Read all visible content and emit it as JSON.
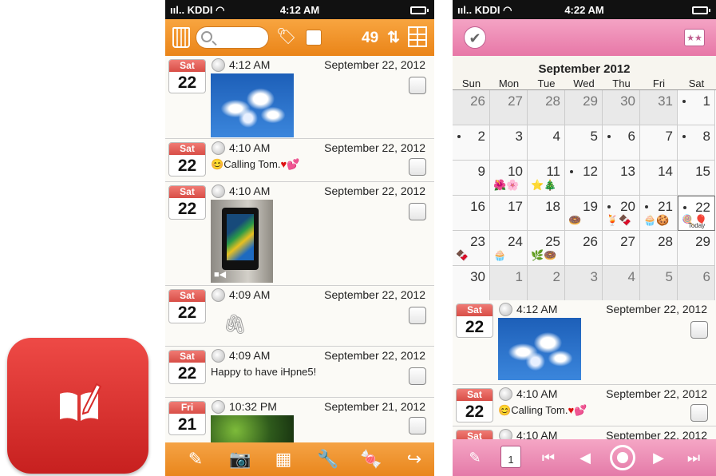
{
  "phone1": {
    "status": {
      "carrier": "KDDI",
      "time": "4:12 AM"
    },
    "toolbar": {
      "search_placeholder": "",
      "count": "49",
      "sort_glyph": "⇅"
    },
    "entries": [
      {
        "dow": "Sat",
        "day": "22",
        "time": "4:12 AM",
        "date": "September 22, 2012",
        "text": ""
      },
      {
        "dow": "Sat",
        "day": "22",
        "time": "4:10 AM",
        "date": "September 22, 2012",
        "text": "Calling Tom."
      },
      {
        "dow": "Sat",
        "day": "22",
        "time": "4:10 AM",
        "date": "September 22, 2012",
        "text": ""
      },
      {
        "dow": "Sat",
        "day": "22",
        "time": "4:09 AM",
        "date": "September 22, 2012",
        "text": ""
      },
      {
        "dow": "Sat",
        "day": "22",
        "time": "4:09 AM",
        "date": "September 22, 2012",
        "text": "Happy to have iHpne5!"
      },
      {
        "dow": "Fri",
        "day": "21",
        "time": "10:32 PM",
        "date": "September 21, 2012",
        "text": ""
      }
    ],
    "bottom_icons": [
      "pencil-icon",
      "camera-icon",
      "calendar-icon",
      "wrench-icon",
      "candy-icon",
      "share-arrow-icon"
    ]
  },
  "phone2": {
    "status": {
      "carrier": "KDDI",
      "time": "4:22 AM"
    },
    "calendar": {
      "title": "September 2012",
      "weekdays": [
        "Sun",
        "Mon",
        "Tue",
        "Wed",
        "Thu",
        "Fri",
        "Sat"
      ],
      "weeks": [
        [
          "26",
          "27",
          "28",
          "29",
          "30",
          "31",
          "1"
        ],
        [
          "2",
          "3",
          "4",
          "5",
          "6",
          "7",
          "8"
        ],
        [
          "9",
          "10",
          "11",
          "12",
          "13",
          "14",
          "15"
        ],
        [
          "16",
          "17",
          "18",
          "19",
          "20",
          "21",
          "22"
        ],
        [
          "23",
          "24",
          "25",
          "26",
          "27",
          "28",
          "29"
        ],
        [
          "30",
          "1",
          "2",
          "3",
          "4",
          "5",
          "6"
        ]
      ],
      "today_label": "Today"
    },
    "entries": [
      {
        "dow": "Sat",
        "day": "22",
        "time": "4:12 AM",
        "date": "September 22, 2012",
        "text": ""
      },
      {
        "dow": "Sat",
        "day": "22",
        "time": "4:10 AM",
        "date": "September 22, 2012",
        "text": "Calling Tom."
      },
      {
        "dow": "Sat",
        "day": "",
        "time": "4:10 AM",
        "date": "September 22, 2012",
        "text": ""
      }
    ],
    "bottom_calendar_day": "1"
  },
  "colors": {
    "orange": "#ea8418",
    "pink": "#e777a7",
    "red_icon": "#d62b29"
  }
}
